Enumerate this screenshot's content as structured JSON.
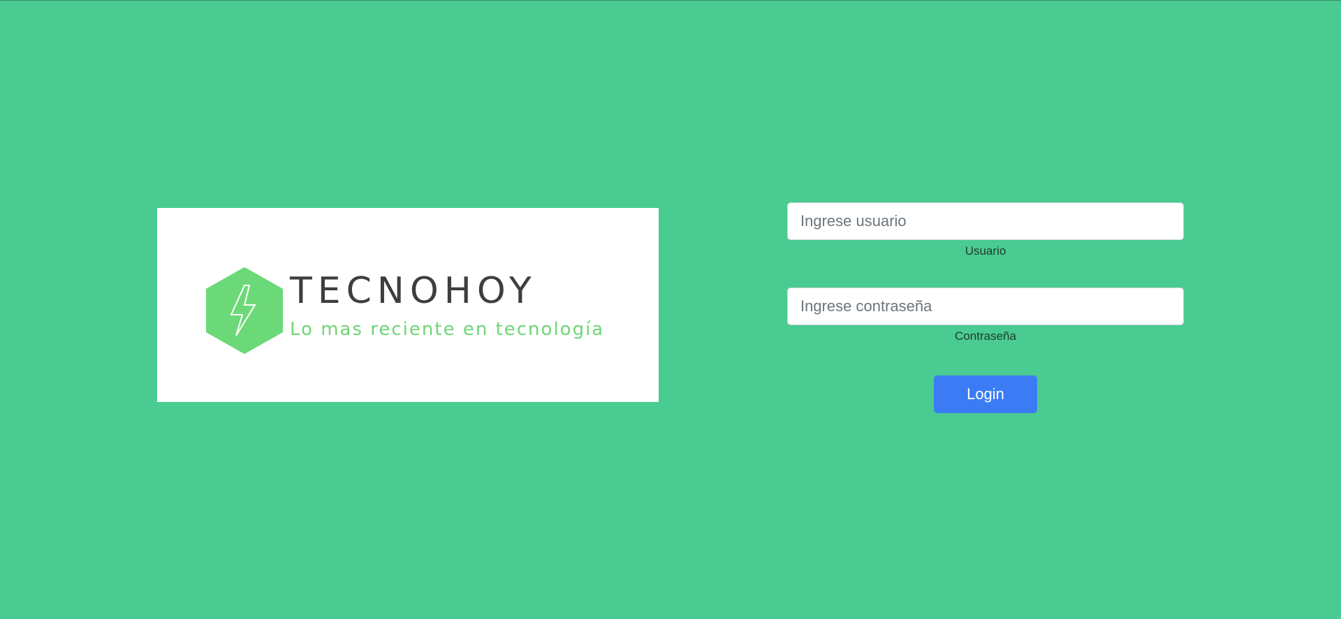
{
  "brand": {
    "name": "TECNOHOY",
    "tagline": "Lo mas reciente en tecnología",
    "colors": {
      "hexagon": "#6cd978",
      "name": "#3e3e40",
      "tagline": "#6fd676"
    }
  },
  "page": {
    "background_color": "#4acb91"
  },
  "login": {
    "username": {
      "placeholder": "Ingrese usuario",
      "value": "",
      "label": "Usuario"
    },
    "password": {
      "placeholder": "Ingrese contraseña",
      "value": "",
      "label": "Contraseña"
    },
    "submit_label": "Login",
    "submit_color": "#3b7cf5"
  }
}
